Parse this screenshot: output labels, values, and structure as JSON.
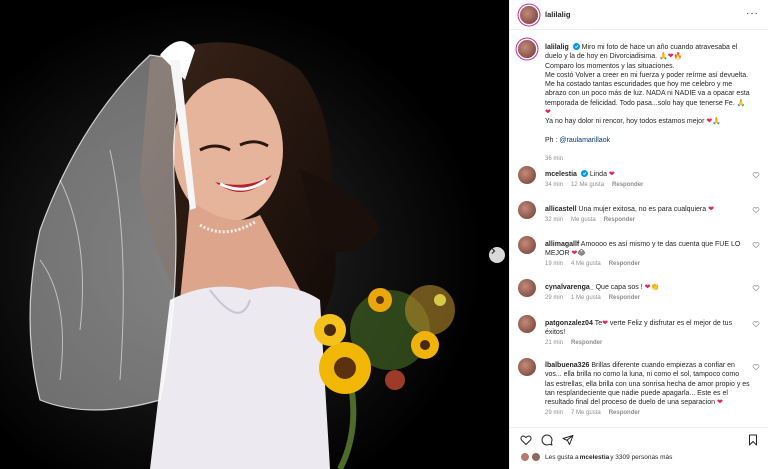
{
  "post": {
    "username": "lalilalig",
    "caption": {
      "username": "lalilalig",
      "line1": "Miro mi foto de hace un año cuando atravesaba el duelo y la de hoy en Divorciadisima.",
      "line2": "Comparo los momentos y las situaciones.",
      "line3": "Me costó Volver a creer en mi fuerza y poder reírme así devuelta. Me ha costado tantas escuridades que hoy me celebro y me abrazo con un poco más de luz. NADA ni NADIE va a opacar esta temporada de felicidad. Todo pasa...solo hay que tenerse Fe.",
      "line4": "Ya no hay dolor ni rencor, hoy todos estamos mejor",
      "credit_prefix": "Ph : ",
      "credit_handle": "@raulamarillaok",
      "time": "36 min"
    },
    "comments": [
      {
        "user": "mcelestia",
        "verified": true,
        "text": "Linda",
        "time": "34 min",
        "likes": "12 Me gusta",
        "reply": "Responder"
      },
      {
        "user": "allicastell",
        "text": "Una mujer exitosa, no es para cualquiera",
        "time": "32 min",
        "likes": "Me gusta",
        "reply": "Responder"
      },
      {
        "user": "allimagallf",
        "text": "Amoooo es así mismo y te das cuenta que FUE LO MEJOR",
        "time": "19 min",
        "likes": "4 Me gusta",
        "reply": "Responder"
      },
      {
        "user": "cynalvarenga_",
        "text": "Que capa sos !",
        "time": "29 min",
        "likes": "1 Me gusta",
        "reply": "Responder"
      },
      {
        "user": "patgonzalez04",
        "text": "Te",
        "text2": "verte Feliz y disfrutar es el mejor de tus éxitos!",
        "time": "21 min",
        "reply": "Responder"
      },
      {
        "user": "lbalbuena326",
        "text": "Brillas diferente cuando empiezas a confiar en vos... ella brilla no como la luna, ni como el sol, tampoco como las estrellas, ella brilla con una sonrisa hecha de amor propio y es tan resplandeciente que nadie puede apagarla... Este es el resultado final del proceso de duelo de una separacion",
        "time": "29 min",
        "likes": "7 Me gusta",
        "reply": "Responder"
      }
    ],
    "liked_by": "Les gusta a mcelestia y 3309 personas más",
    "liked_by_prefix": "Les gusta a ",
    "liked_by_user": "mcelestia",
    "liked_by_suffix": " y 3309 personas más"
  },
  "icons": [
    "heart-icon",
    "comment-icon",
    "share-icon",
    "bookmark-icon",
    "more-options-icon",
    "chevron-right-icon",
    "verified-icon"
  ],
  "colors": {
    "accent": "#0095f6",
    "heart": "#e0245e",
    "text": "#262626",
    "muted": "#8e8e8e"
  }
}
